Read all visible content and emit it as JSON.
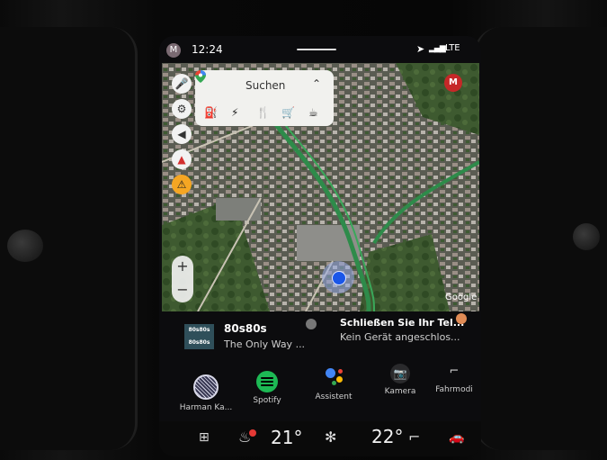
{
  "status_bar": {
    "avatar_letter": "M",
    "time": "12:24",
    "network": "LTE"
  },
  "map": {
    "search_label": "Suchen",
    "categories": [
      {
        "icon": "fuel-icon",
        "glyph": "⛽"
      },
      {
        "icon": "charging-icon",
        "glyph": "⚡"
      },
      {
        "icon": "restaurant-icon",
        "glyph": "🍴"
      },
      {
        "icon": "shopping-cart-icon",
        "glyph": "🛒"
      },
      {
        "icon": "coffee-icon",
        "glyph": "☕"
      }
    ],
    "profile_letter": "M",
    "attribution": "Google",
    "left_buttons": [
      {
        "name": "microphone-icon",
        "glyph": "🎤"
      },
      {
        "name": "settings-icon",
        "glyph": "⚙"
      },
      {
        "name": "sound-icon",
        "glyph": "🔈"
      },
      {
        "name": "compass-icon",
        "glyph": "▲"
      },
      {
        "name": "report-incident-icon",
        "glyph": "⚠"
      }
    ],
    "zoom_in": "+",
    "zoom_out": "−"
  },
  "media": {
    "album_label": "80s80s",
    "station": "80s80s",
    "song": "The Only Way ..."
  },
  "phone": {
    "title": "Schließen Sie Ihr Tel...",
    "subtitle": "Kein Gerät angeschlos..."
  },
  "apps": [
    {
      "label": "Harman Ka..."
    },
    {
      "label": "Spotify"
    },
    {
      "label": "Assistent"
    },
    {
      "label": "Kamera"
    },
    {
      "label": "Fahrmodi"
    }
  ],
  "climate": {
    "driver_temp": "21°",
    "passenger_temp": "22°"
  }
}
